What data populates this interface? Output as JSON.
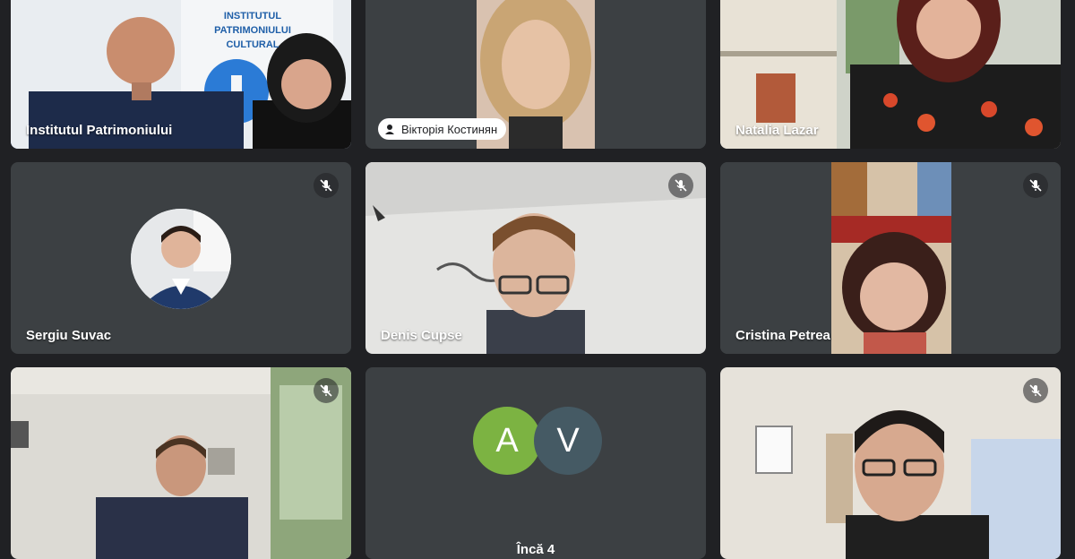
{
  "participants": [
    {
      "name": "Institutul Patrimoniului",
      "active": true
    },
    {
      "name": "Вікторія Костинян"
    },
    {
      "name": "Natalia Lazar"
    },
    {
      "name": "Sergiu Suvac",
      "muted": true
    },
    {
      "name": "Denis Cupse",
      "muted": true
    },
    {
      "name": "Cristina Petrea",
      "muted": true
    },
    {
      "name": "",
      "muted": true
    },
    {
      "name": "",
      "muted": true
    }
  ],
  "background_sign": [
    "INSTITUTUL",
    "PATRIMONIULUI",
    "CULTURAL"
  ],
  "overflow": {
    "initials": [
      "A",
      "V"
    ],
    "colors": [
      "#7cb342",
      "#455a64"
    ],
    "label": "Încă 4"
  },
  "colors": {
    "background": "#202124",
    "tile": "#3c4043",
    "active_border": "#8ab4f8"
  }
}
